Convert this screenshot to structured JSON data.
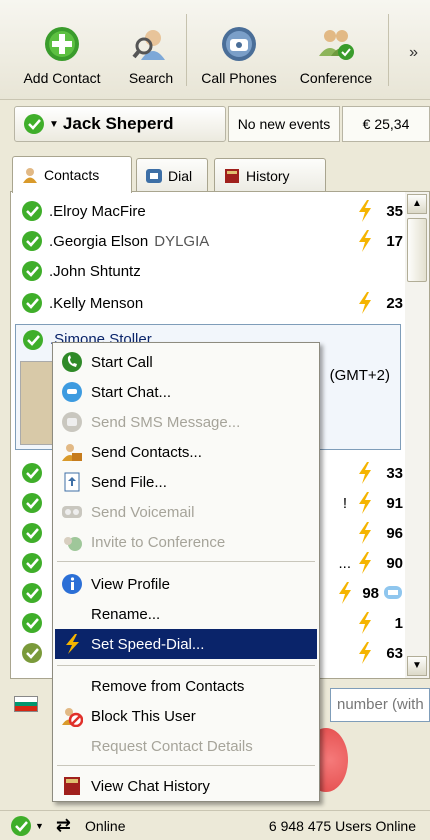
{
  "toolbar": {
    "add_contact": "Add Contact",
    "search": "Search",
    "call_phones": "Call Phones",
    "conference": "Conference",
    "more": "»"
  },
  "status": {
    "user_name": "Jack Sheperd",
    "events": "No new events",
    "credit": "€ 25,34"
  },
  "tabs": [
    "Contacts",
    "Dial",
    "History"
  ],
  "contacts": [
    {
      "name": ".Elroy MacFire",
      "mood": "",
      "speed_dial": "35"
    },
    {
      "name": ".Georgia Elson",
      "mood": "DYLGIA",
      "speed_dial": "17"
    },
    {
      "name": ".John Shtuntz",
      "mood": "",
      "speed_dial": ""
    },
    {
      "name": ".Kelly Menson",
      "mood": "",
      "speed_dial": "23"
    }
  ],
  "selected_contact": {
    "name": ".Simone Stoller",
    "timezone": "(GMT+2)"
  },
  "lower_speed_dials": [
    "33",
    "91",
    "96",
    "90",
    "98",
    "1",
    "63"
  ],
  "lower_fragments": {
    "row2": "!",
    "row4": "..."
  },
  "context_menu": {
    "start_call": "Start Call",
    "start_chat": "Start Chat...",
    "send_sms": "Send SMS Message...",
    "send_contacts": "Send Contacts...",
    "send_file": "Send File...",
    "send_voicemail": "Send Voicemail",
    "invite_conference": "Invite to Conference",
    "view_profile": "View Profile",
    "rename": "Rename...",
    "set_speed_dial": "Set Speed-Dial...",
    "remove": "Remove from Contacts",
    "block": "Block This User",
    "request_details": "Request Contact Details",
    "view_history": "View Chat History"
  },
  "dial": {
    "placeholder_fragment": "number (with"
  },
  "statusbar": {
    "status": "Online",
    "users_online": "6 948 475 Users Online"
  },
  "colors": {
    "online_green": "#3fae2a",
    "highlight": "#0a246a",
    "bolt": "#f5b400"
  }
}
